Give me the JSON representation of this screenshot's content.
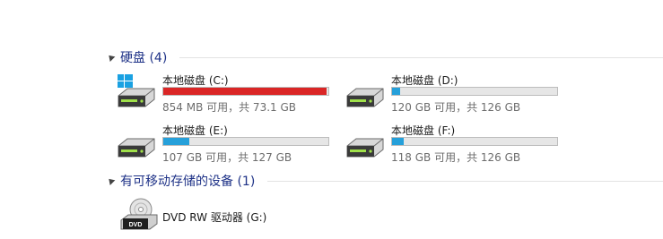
{
  "hard_disks": {
    "header": "硬盘 (4)",
    "drives": [
      {
        "name": "本地磁盘 (C:)",
        "free_text": "854 MB 可用，共 73.1 GB",
        "used_fraction": 0.99,
        "status": "critical",
        "icon": "windows-system-drive-icon"
      },
      {
        "name": "本地磁盘 (D:)",
        "free_text": "120 GB 可用，共 126 GB",
        "used_fraction": 0.05,
        "status": "normal",
        "icon": "hard-drive-icon"
      },
      {
        "name": "本地磁盘 (E:)",
        "free_text": "107 GB 可用，共 127 GB",
        "used_fraction": 0.16,
        "status": "normal",
        "icon": "hard-drive-icon"
      },
      {
        "name": "本地磁盘 (F:)",
        "free_text": "118 GB 可用，共 126 GB",
        "used_fraction": 0.07,
        "status": "normal",
        "icon": "hard-drive-icon"
      }
    ]
  },
  "removable": {
    "header": "有可移动存储的设备 (1)",
    "devices": [
      {
        "name": "DVD RW 驱动器 (G:)",
        "icon": "dvd-drive-icon"
      }
    ]
  },
  "colors": {
    "bar_normal": "#26a0da",
    "bar_critical": "#da2626",
    "header_text": "#1e3287"
  }
}
